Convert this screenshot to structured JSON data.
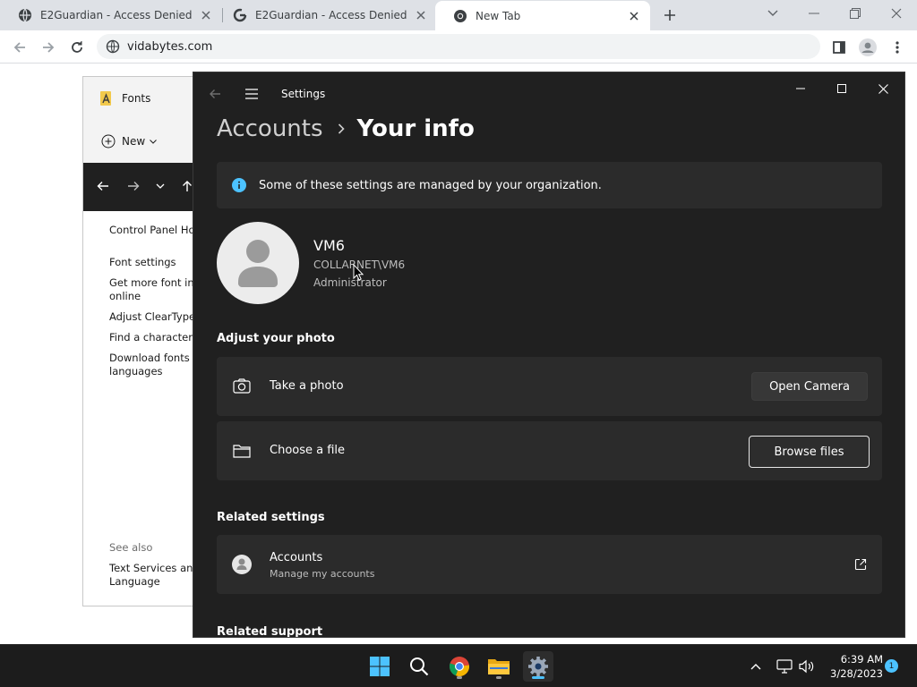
{
  "browser": {
    "tabs": [
      {
        "title": "E2Guardian - Access Denied",
        "favicon": "globe-icon"
      },
      {
        "title": "E2Guardian - Access Denied",
        "favicon": "google-g-icon"
      },
      {
        "title": "New Tab",
        "favicon": "chrome-icon",
        "active": true
      }
    ],
    "url": "vidabytes.com"
  },
  "fonts_window": {
    "title": "Fonts",
    "new_label": "New",
    "links": {
      "control_panel_home": "Control Panel Hom",
      "font_settings": "Font settings",
      "get_more_1": "Get more font info",
      "get_more_2": "online",
      "cleartype": "Adjust ClearType t",
      "find_char": "Find a character",
      "download_1": "Download fonts fo",
      "download_2": "languages",
      "see_also": "See also",
      "text_services_1": "Text Services and I",
      "text_services_2": "Language"
    }
  },
  "settings": {
    "app_title": "Settings",
    "breadcrumb": {
      "parent": "Accounts",
      "current": "Your info"
    },
    "banner": "Some of these settings are managed by your organization.",
    "user": {
      "name": "VM6",
      "domain": "COLLARNET\\VM6",
      "role": "Administrator"
    },
    "adjust_photo": {
      "heading": "Adjust your photo",
      "take_photo": "Take a photo",
      "open_camera": "Open Camera",
      "choose_file": "Choose a file",
      "browse_files": "Browse files"
    },
    "related_settings": {
      "heading": "Related settings",
      "accounts_title": "Accounts",
      "accounts_sub": "Manage my accounts"
    },
    "related_support": {
      "heading": "Related support"
    }
  },
  "taskbar": {
    "time": "6:39 AM",
    "date": "3/28/2023",
    "notifications": "1"
  },
  "colors": {
    "settings_bg": "#202020",
    "card_bg": "#2b2b2b",
    "accent": "#4cc2ff"
  }
}
